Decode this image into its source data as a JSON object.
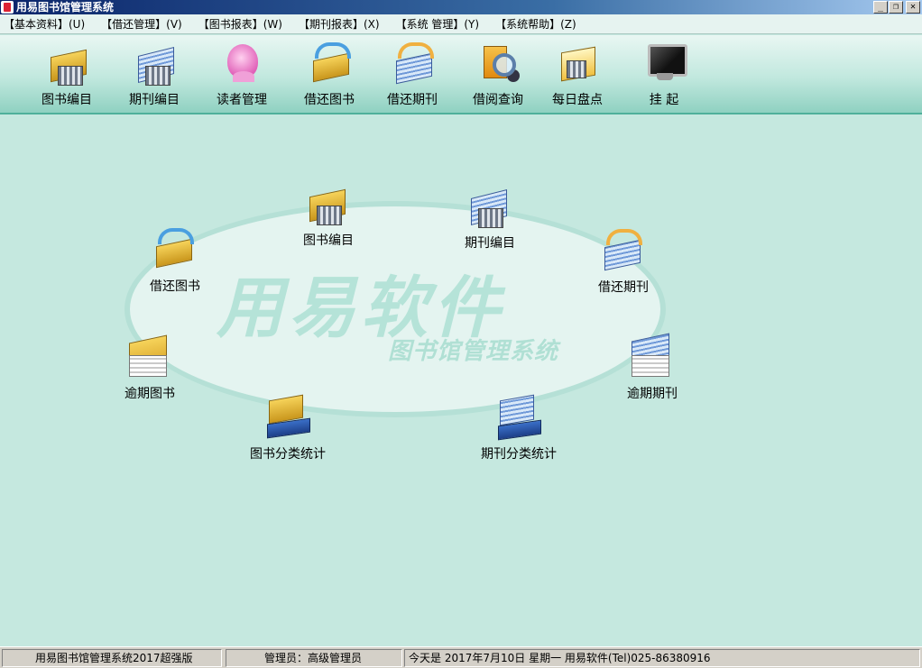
{
  "window": {
    "title": "用易图书馆管理系统",
    "buttons": [
      "_",
      "❐",
      "✕"
    ]
  },
  "menu": [
    "【基本资料】(U)",
    "【借还管理】(V)",
    "【图书报表】(W)",
    "【期刊报表】(X)",
    "【系统 管理】(Y)",
    "【系统帮助】(Z)"
  ],
  "toolbar": [
    {
      "label": "图书编目",
      "icon": "book-catalog-icon"
    },
    {
      "label": "期刊编目",
      "icon": "periodical-catalog-icon"
    },
    {
      "label": "读者管理",
      "icon": "reader-icon"
    },
    {
      "label": "借还图书",
      "icon": "book-return-icon"
    },
    {
      "label": "借还期刊",
      "icon": "periodical-return-icon"
    },
    {
      "label": "借阅查询",
      "icon": "search-icon"
    },
    {
      "label": "每日盘点",
      "icon": "inventory-icon"
    },
    {
      "label": "挂 起",
      "icon": "monitor-icon"
    }
  ],
  "watermark": {
    "brand": "用易软件",
    "subtitle": "图书馆管理系统"
  },
  "nodes": [
    {
      "label": "图书编目",
      "icon": "book-catalog-icon"
    },
    {
      "label": "期刊编目",
      "icon": "periodical-catalog-icon"
    },
    {
      "label": "借还图书",
      "icon": "book-return-icon"
    },
    {
      "label": "借还期刊",
      "icon": "periodical-return-icon"
    },
    {
      "label": "逾期图书",
      "icon": "overdue-book-icon"
    },
    {
      "label": "逾期期刊",
      "icon": "overdue-periodical-icon"
    },
    {
      "label": "图书分类统计",
      "icon": "book-stats-icon"
    },
    {
      "label": "期刊分类统计",
      "icon": "periodical-stats-icon"
    }
  ],
  "status": {
    "product": "用易图书馆管理系统2017超强版",
    "user": "管理员：高级管理员",
    "info": "今天是 2017年7月10日  星期一  用易软件(Tel)025-86380916"
  }
}
